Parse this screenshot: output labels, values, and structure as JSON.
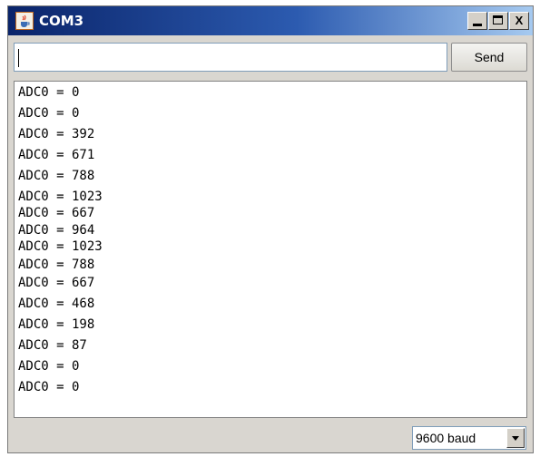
{
  "window": {
    "title": "COM3",
    "controls": {
      "minimize": "_",
      "maximize": "□",
      "close": "X"
    }
  },
  "input": {
    "value": "",
    "placeholder": ""
  },
  "send_button": {
    "label": "Send"
  },
  "output_lines": [
    "ADC0 = 0",
    "ADC0 = 0",
    "ADC0 = 392",
    "ADC0 = 671",
    "ADC0 = 788",
    "ADC0 = 1023",
    "ADC0 = 667",
    "ADC0 = 964",
    "ADC0 = 1023",
    "ADC0 = 788",
    "ADC0 = 667",
    "ADC0 = 468",
    "ADC0 = 198",
    "ADC0 = 87",
    "ADC0 = 0",
    "ADC0 = 0"
  ],
  "baud_select": {
    "selected": "9600 baud"
  },
  "icons": {
    "app": "java-cup-icon",
    "dropdown": "chevron-down-icon"
  },
  "colors": {
    "titlebar_start": "#0a246a",
    "titlebar_end": "#a6caf0",
    "window_bg": "#d9d6d0"
  }
}
